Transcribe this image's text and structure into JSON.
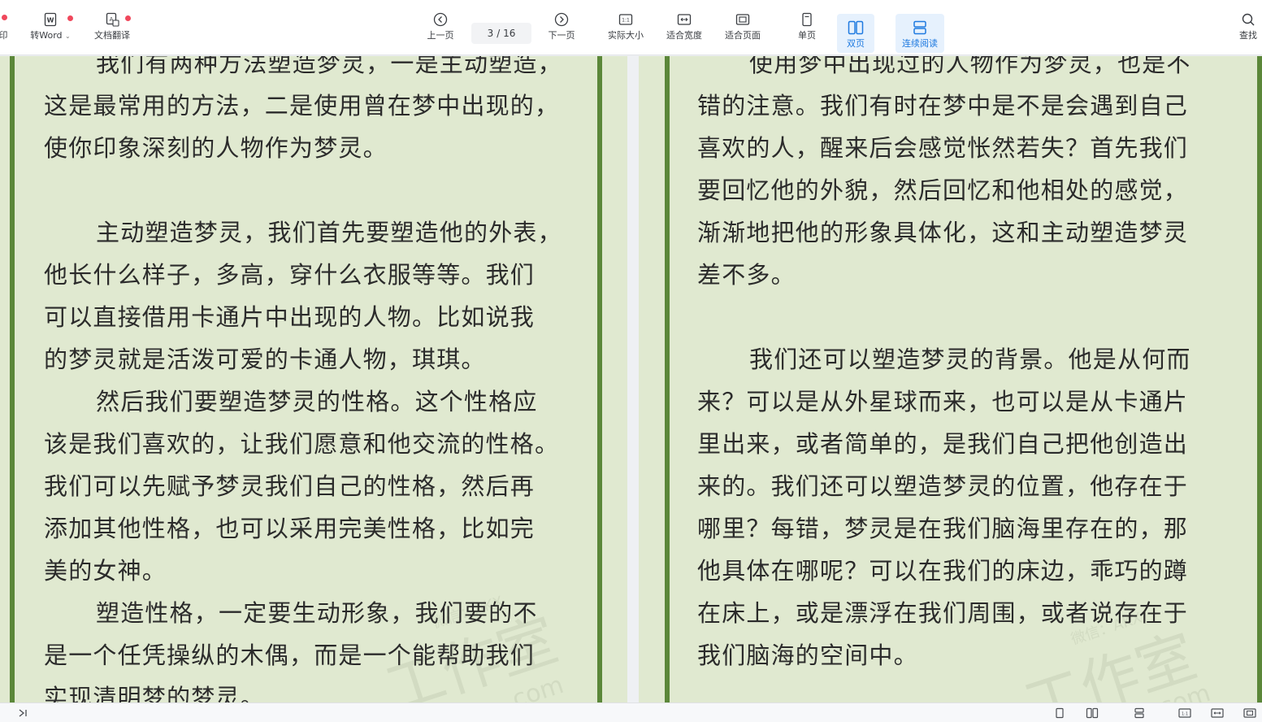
{
  "toolbar": {
    "print_label": "印",
    "to_word_label": "转Word",
    "translate_label": "文档翻译",
    "prev_label": "上一页",
    "page_current": "3",
    "page_total": "/ 16",
    "next_label": "下一页",
    "actual_size_label": "实际大小",
    "fit_width_label": "适合宽度",
    "fit_page_label": "适合页面",
    "single_page_label": "单页",
    "double_page_label": "双页",
    "continuous_label": "连续阅读",
    "search_label": "查找"
  },
  "colors": {
    "page_background": "#e0e9d0",
    "page_border_bar": "#5b8739",
    "active_accent": "#1f7ae0",
    "notification_dot": "#f0485c"
  },
  "left_page": {
    "lines": [
      "我们有两种方法塑造梦灵，一是主动塑造，",
      "这是最常用的方法，二是使用曾在梦中出现的，",
      "使你印象深刻的人物作为梦灵。",
      "",
      "主动塑造梦灵，我们首先要塑造他的外表，",
      "他长什么样子，多高，穿什么衣服等等。我们",
      "可以直接借用卡通片中出现的人物。比如说我",
      "的梦灵就是活泼可爱的卡通人物，琪琪。",
      "然后我们要塑造梦灵的性格。这个性格应",
      "该是我们喜欢的，让我们愿意和他交流的性格。",
      "我们可以先赋予梦灵我们自己的性格，然后再",
      "添加其他性格，也可以采用完美性格，比如完",
      "美的女神。",
      "塑造性格，一定要生动形象，我们要的不",
      "是一个任凭操纵的木偶，而是一个能帮助我们",
      "实现清明梦的梦灵。"
    ]
  },
  "right_page": {
    "lines": [
      "使用梦中出现过的人物作为梦灵，也是不",
      "错的注意。我们有时在梦中是不是会遇到自己",
      "喜欢的人，醒来后会感觉怅然若失？首先我们",
      "要回忆他的外貌，然后回忆和他相处的感觉，",
      "渐渐地把他的形象具体化，这和主动塑造梦灵",
      "差不多。",
      "",
      "我们还可以塑造梦灵的背景。他是从何而",
      "来？可以是从外星球而来，也可以是从卡通片",
      "里出来，或者简单的，是我们自己把他创造出",
      "来的。我们还可以塑造梦灵的位置，他存在于",
      "哪里？每错，梦灵是在我们脑海里存在的，那",
      "他具体在哪呢？可以在我们的床边，乖巧的蹲",
      "在床上，或是漂浮在我们周围，或者说存在于",
      "我们脑海的空间中。"
    ]
  },
  "watermark": {
    "line1": "微信：AKX",
    "line2": "工作室",
    "line3": "com"
  }
}
